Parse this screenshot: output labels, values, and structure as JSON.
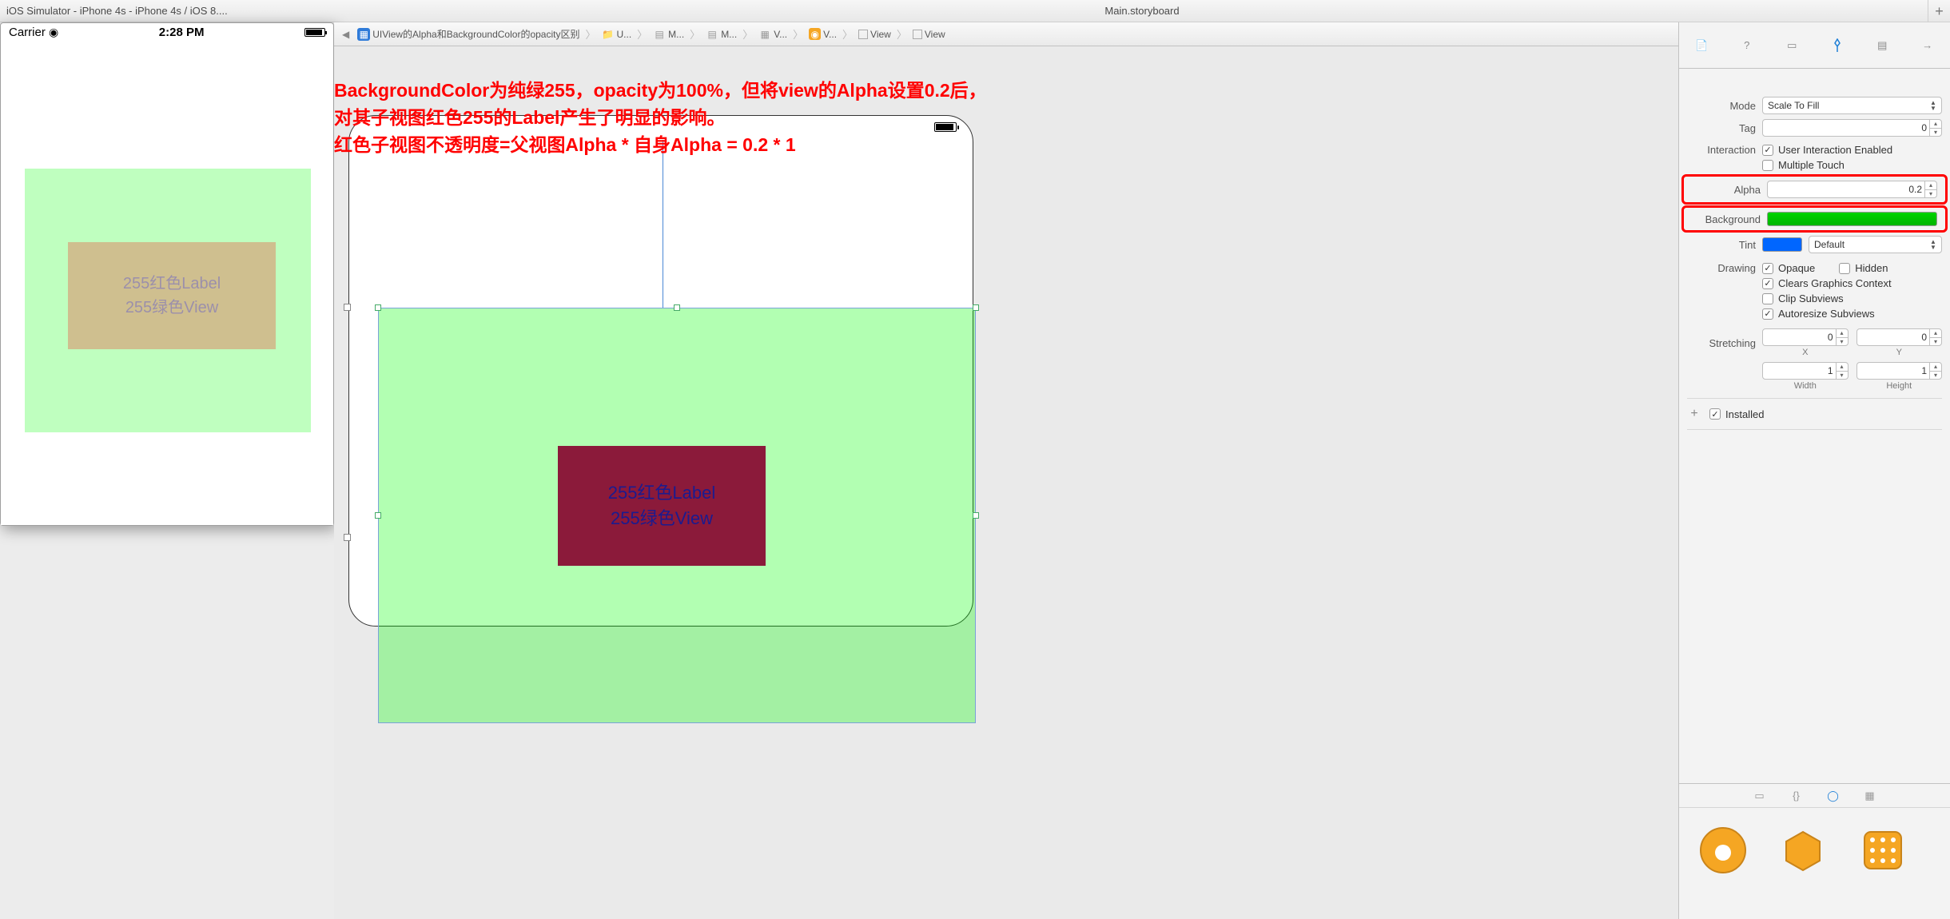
{
  "simTitle": "iOS Simulator - iPhone 4s - iPhone 4s / iOS 8....",
  "mainTitle": "Main.storyboard",
  "simStatus": {
    "carrier": "Carrier",
    "time": "2:28 PM"
  },
  "simLabel": {
    "line1": "255红色Label",
    "line2": "255绿色View"
  },
  "nav": {
    "proj": "UIView的Alpha和BackgroundColor的opacity区别",
    "items": [
      "U...",
      "M...",
      "M...",
      "V...",
      "V...",
      "View",
      "View"
    ]
  },
  "annotation": "BackgroundColor为纯绿255，opacity为100%，但将view的Alpha设置0.2后，\n对其子视图红色255的Label产生了明显的影响。\n红色子视图不透明度=父视图Alpha * 自身Alpha = 0.2 * 1",
  "canvasLabel": {
    "line1": "255红色Label",
    "line2": "255绿色View"
  },
  "inspector": {
    "modeLabel": "Mode",
    "modeValue": "Scale To Fill",
    "tagLabel": "Tag",
    "tagValue": "0",
    "interactionLabel": "Interaction",
    "userInteraction": "User Interaction Enabled",
    "multipleTouch": "Multiple Touch",
    "alphaLabel": "Alpha",
    "alphaValue": "0.2",
    "backgroundLabel": "Background",
    "tintLabel": "Tint",
    "tintValue": "Default",
    "drawingLabel": "Drawing",
    "opaque": "Opaque",
    "hidden": "Hidden",
    "clears": "Clears Graphics Context",
    "clip": "Clip Subviews",
    "autoresize": "Autoresize Subviews",
    "stretchingLabel": "Stretching",
    "x": "0",
    "y": "0",
    "xLabel": "X",
    "yLabel": "Y",
    "w": "1",
    "h": "1",
    "wLabel": "Width",
    "hLabel": "Height",
    "installed": "Installed"
  }
}
